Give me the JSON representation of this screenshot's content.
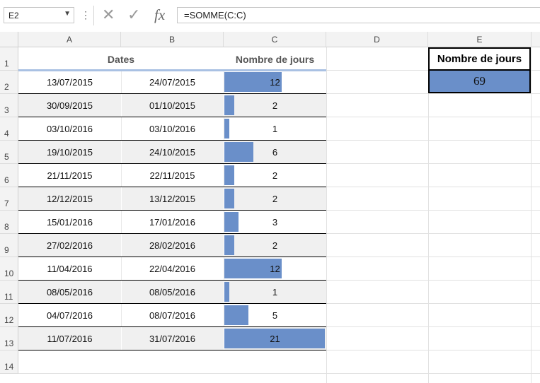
{
  "name_box": {
    "value": "E2",
    "dropdown_icon": "chevron-down-icon"
  },
  "formula_bar": {
    "more_icon": "more-vertical-icon",
    "cancel_icon": "close-icon",
    "confirm_icon": "check-icon",
    "fx_label": "fx",
    "formula": "=SOMME(C:C)"
  },
  "columns": [
    "A",
    "B",
    "C",
    "D",
    "E"
  ],
  "rows": [
    "1",
    "2",
    "3",
    "4",
    "5",
    "6",
    "7",
    "8",
    "9",
    "10",
    "11",
    "12",
    "13",
    "14"
  ],
  "table": {
    "header_dates": "Dates",
    "header_days": "Nombre de jours",
    "bar_max": 21,
    "records": [
      {
        "start": "13/07/2015",
        "end": "24/07/2015",
        "days": 12
      },
      {
        "start": "30/09/2015",
        "end": "01/10/2015",
        "days": 2
      },
      {
        "start": "03/10/2016",
        "end": "03/10/2016",
        "days": 1
      },
      {
        "start": "19/10/2015",
        "end": "24/10/2015",
        "days": 6
      },
      {
        "start": "21/11/2015",
        "end": "22/11/2015",
        "days": 2
      },
      {
        "start": "12/12/2015",
        "end": "13/12/2015",
        "days": 2
      },
      {
        "start": "15/01/2016",
        "end": "17/01/2016",
        "days": 3
      },
      {
        "start": "27/02/2016",
        "end": "28/02/2016",
        "days": 2
      },
      {
        "start": "11/04/2016",
        "end": "22/04/2016",
        "days": 12
      },
      {
        "start": "08/05/2016",
        "end": "08/05/2016",
        "days": 1
      },
      {
        "start": "04/07/2016",
        "end": "08/07/2016",
        "days": 5
      },
      {
        "start": "11/07/2016",
        "end": "31/07/2016",
        "days": 21
      }
    ]
  },
  "summary": {
    "header": "Nombre de jours",
    "value": "69"
  },
  "colors": {
    "bar": "#6a8fc9",
    "alt_row": "#f0f0f0",
    "header_underline": "#a9c1e3"
  }
}
